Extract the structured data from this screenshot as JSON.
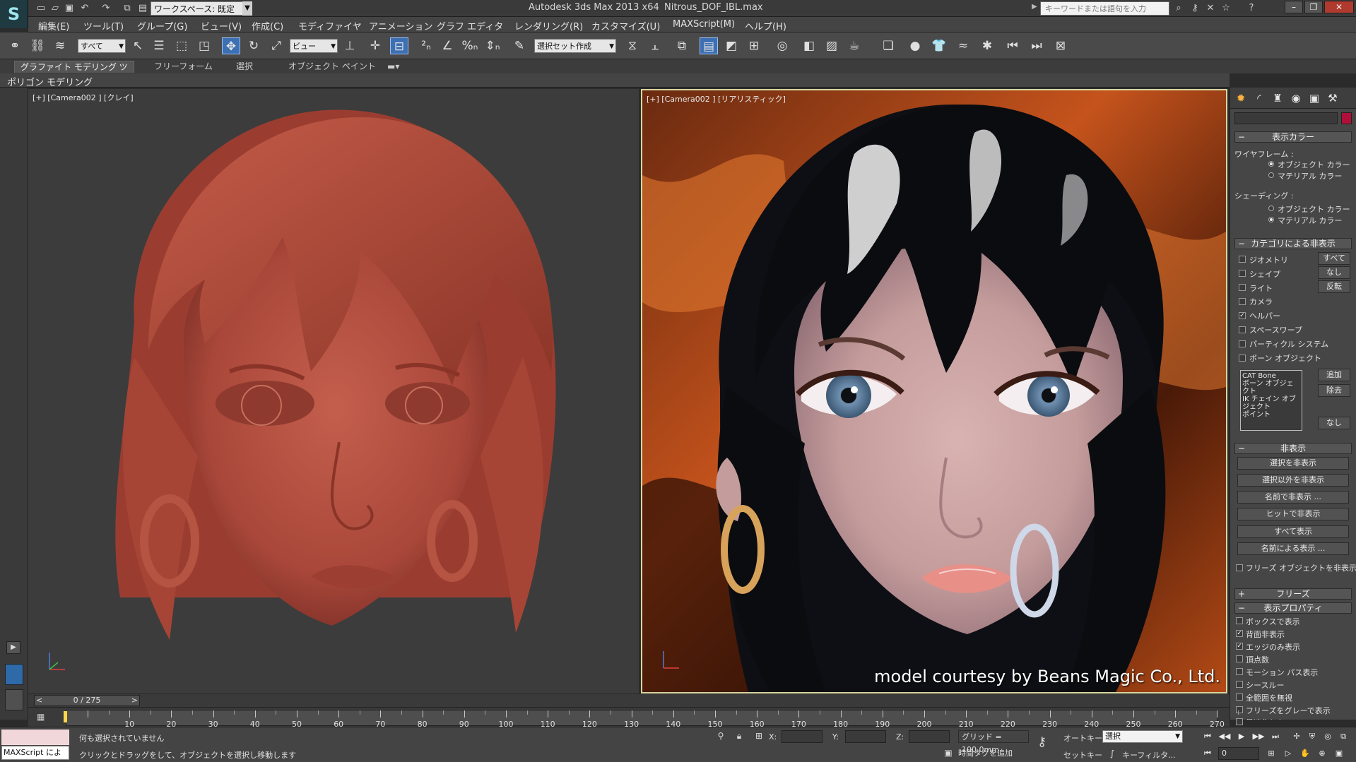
{
  "titlebar": {
    "logo": "S",
    "workspace": "ワークスペース: 既定",
    "app_title": "Autodesk 3ds Max  2013 x64",
    "file_title": "Nitrous_DOF_IBL.max",
    "search_placeholder": "キーワードまたは語句を入力"
  },
  "menu": [
    "編集(E)",
    "ツール(T)",
    "グループ(G)",
    "ビュー(V)",
    "作成(C)",
    "モディファイヤ",
    "アニメーション",
    "グラフ エディタ",
    "レンダリング(R)",
    "カスタマイズ(U)",
    "MAXScript(M)",
    "ヘルプ(H)"
  ],
  "toolbar": {
    "selection_filter": "すべて",
    "ref_coord": "ビュー",
    "named_selection": "選択セット作成"
  },
  "ribbon": {
    "tabs": [
      "グラファイト モデリング ツール",
      "フリーフォーム",
      "選択",
      "オブジェクト ペイント"
    ],
    "panel_label": "ポリゴン モデリング"
  },
  "viewports": {
    "left_label": "[+] [Camera002 ] [クレイ]",
    "right_label": "[+] [Camera002 ] [リアリスティック]",
    "credit": "model courtesy by Beans Magic Co., Ltd."
  },
  "command_panel": {
    "display_color": {
      "header": "表示カラー",
      "wireframe_label": "ワイヤフレーム :",
      "wireframe_options": [
        "オブジェクト カラー",
        "マテリアル カラー"
      ],
      "shading_label": "シェーディング :",
      "shading_options": [
        "オブジェクト カラー",
        "マテリアル カラー"
      ]
    },
    "hide_by_category": {
      "header": "カテゴリによる非表示",
      "items": [
        "ジオメトリ",
        "シェイプ",
        "ライト",
        "カメラ",
        "ヘルパー",
        "スペースワープ",
        "パーティクル システム",
        "ボーン オブジェクト"
      ],
      "buttons": [
        "すべて",
        "なし",
        "反転"
      ],
      "list": [
        "CAT Bone",
        "ボーン オブジェクト",
        "IK チェイン オブジェクト",
        "ポイント"
      ],
      "list_buttons": [
        "追加",
        "除去",
        "なし"
      ]
    },
    "hide": {
      "header": "非表示",
      "buttons": [
        "選択を非表示",
        "選択以外を非表示",
        "名前で非表示 ...",
        "ヒットで非表示",
        "すべて表示",
        "名前による表示 ..."
      ],
      "freeze_check": "フリーズ オブジェクトを非表示"
    },
    "freeze": {
      "header": "フリーズ"
    },
    "display_props": {
      "header": "表示プロパティ",
      "items": [
        "ボックスで表示",
        "背面非表示",
        "エッジのみ表示",
        "頂点数",
        "モーション パス表示",
        "シースルー",
        "全範囲を無視",
        "フリーズをグレーで表示",
        "最適化しない"
      ]
    }
  },
  "timeline": {
    "slider": "0 / 275",
    "ticks": [
      "10",
      "20",
      "30",
      "40",
      "50",
      "60",
      "70",
      "80",
      "90",
      "100",
      "110",
      "120",
      "130",
      "140",
      "150",
      "160",
      "170",
      "180",
      "190",
      "200",
      "210",
      "220",
      "230",
      "240",
      "250",
      "260",
      "270"
    ]
  },
  "statusbar": {
    "maxscript": "MAXScript による",
    "status": "何も選択されていません",
    "prompt": "クリックとドラッグをして、オブジェクトを選択し移動します",
    "x_label": "X:",
    "y_label": "Y:",
    "z_label": "Z:",
    "grid": "グリッド = 100.0mm",
    "add_time_tag": "時間タグを追加",
    "autokey": "オートキー",
    "setkey": "セットキー",
    "key_mode": "選択",
    "key_filter": "キーフィルタ...",
    "frame": "0"
  }
}
